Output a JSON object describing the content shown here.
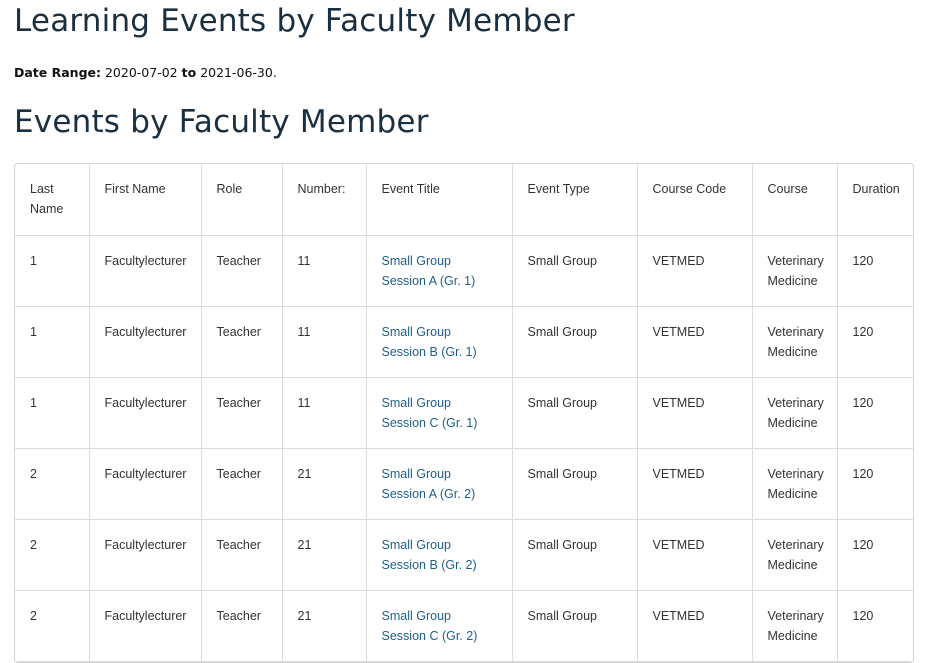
{
  "report": {
    "title": "Learning Events by Faculty Member",
    "date_range_label": "Date Range:",
    "date_start": "2020-07-02",
    "date_to": "to",
    "date_end": "2021-06-30",
    "date_suffix": "."
  },
  "section": {
    "title": "Events by Faculty Member"
  },
  "table": {
    "headers": [
      "Last Name",
      "First Name",
      "Role",
      "Number:",
      "Event Title",
      "Event Type",
      "Course Code",
      "Course",
      "Duration"
    ],
    "rows": [
      {
        "last_name": "1",
        "first_name": "Facultylecturer",
        "role": "Teacher",
        "number": "11",
        "event_title": "Small Group Session A (Gr. 1)",
        "event_type": "Small Group",
        "course_code": "VETMED",
        "course": "Veterinary Medicine",
        "duration": "120"
      },
      {
        "last_name": "1",
        "first_name": "Facultylecturer",
        "role": "Teacher",
        "number": "11",
        "event_title": "Small Group Session B (Gr. 1)",
        "event_type": "Small Group",
        "course_code": "VETMED",
        "course": "Veterinary Medicine",
        "duration": "120"
      },
      {
        "last_name": "1",
        "first_name": "Facultylecturer",
        "role": "Teacher",
        "number": "11",
        "event_title": "Small Group Session C (Gr. 1)",
        "event_type": "Small Group",
        "course_code": "VETMED",
        "course": "Veterinary Medicine",
        "duration": "120"
      },
      {
        "last_name": "2",
        "first_name": "Facultylecturer",
        "role": "Teacher",
        "number": "21",
        "event_title": "Small Group Session A (Gr. 2)",
        "event_type": "Small Group",
        "course_code": "VETMED",
        "course": "Veterinary Medicine",
        "duration": "120"
      },
      {
        "last_name": "2",
        "first_name": "Facultylecturer",
        "role": "Teacher",
        "number": "21",
        "event_title": "Small Group Session B (Gr. 2)",
        "event_type": "Small Group",
        "course_code": "VETMED",
        "course": "Veterinary Medicine",
        "duration": "120"
      },
      {
        "last_name": "2",
        "first_name": "Facultylecturer",
        "role": "Teacher",
        "number": "21",
        "event_title": "Small Group Session C (Gr. 2)",
        "event_type": "Small Group",
        "course_code": "VETMED",
        "course": "Veterinary Medicine",
        "duration": "120"
      }
    ]
  },
  "colors": {
    "heading": "#1a2f40",
    "link": "#1d5f8a",
    "border": "#dcdcdc"
  }
}
